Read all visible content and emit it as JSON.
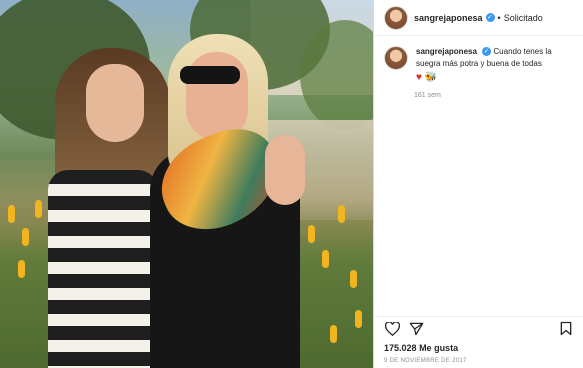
{
  "post": {
    "username": "sangrejaponesa",
    "follow_status": "Solicitado",
    "separator": "•",
    "caption_line1": "Cuando tenes la",
    "caption_line2": "suegra más potra y buena de todas",
    "emojis": "♥ 🐝",
    "time_ago": "161 sem",
    "likes_count": "175.028",
    "likes_label": "Me gusta",
    "date": "9 DE NOVIEMBRE DE 2017"
  },
  "icons": {
    "like": "heart-icon",
    "share": "send-icon",
    "save": "bookmark-icon",
    "verified": "verified-badge-icon"
  },
  "colors": {
    "verified": "#3897f0",
    "heart_emoji": "#d22b2b",
    "muted": "#8e8e8e"
  }
}
